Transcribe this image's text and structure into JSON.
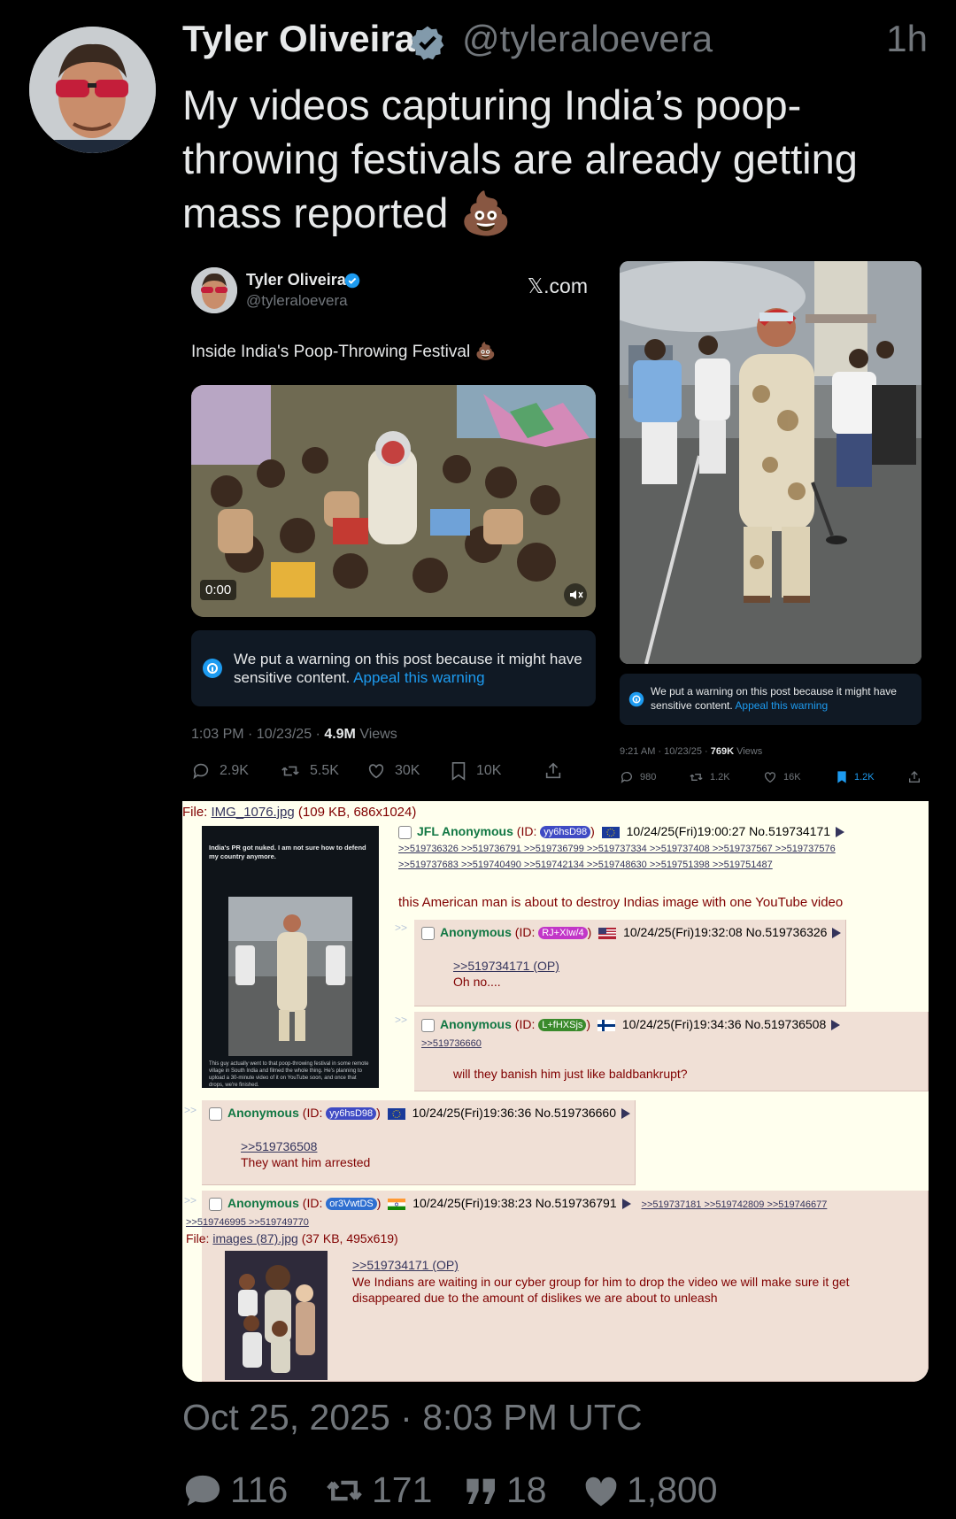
{
  "tweet": {
    "author_name": "Tyler Oliveira",
    "handle": "@tyleraloevera",
    "time_ago": "1h",
    "text": "My videos capturing India’s poop-throwing festivals are already getting mass reported 💩",
    "date_line": "Oct 25, 2025 · 8:03 PM UTC",
    "stats": {
      "replies": "116",
      "retweets": "171",
      "quotes": "18",
      "likes": "1,800"
    }
  },
  "embed1": {
    "author_name": "Tyler Oliveira",
    "handle": "@tyleraloevera",
    "site": "𝕏.com",
    "title": "Inside India's Poop-Throwing Festival 💩",
    "video_time": "0:00",
    "warning_text": "We put a warning on this post because it might have sensitive content.",
    "warning_link": "Appeal this warning",
    "meta_time": "1:03 PM · 10/23/25 · ",
    "meta_views_value": "4.9M",
    "meta_views_label": " Views",
    "actions": {
      "replies": "2.9K",
      "retweets": "5.5K",
      "likes": "30K",
      "bookmarks": "10K"
    }
  },
  "embed2": {
    "warning_text": "We put a warning on this post because it might have sensitive content.",
    "warning_link": "Appeal this warning",
    "meta_time": "9:21 AM · 10/23/25 · ",
    "meta_views_value": "769K",
    "meta_views_label": " Views",
    "actions": {
      "replies": "980",
      "retweets": "1.2K",
      "likes": "16K",
      "bookmarks": "1.2K"
    }
  },
  "chan": {
    "file_label": "File: ",
    "file_name": "IMG_1076.jpg",
    "file_info": " (109 KB, 686x1024)",
    "thumb_text_top": "India's PR got nuked. I am not sure how to defend my country anymore.",
    "thumb_text_bottom": "This guy actually went to that poop-throwing festival in some remote village in South India and filmed the whole thing. He's planning to upload a 30-minute video of it on YouTube soon, and once that drops, we're finished.",
    "op": {
      "name": "JFL Anonymous",
      "id": "yy6hsD98",
      "datetime": "10/24/25(Fri)19:00:27 No.519734171",
      "backlinks1": ">>519736326 >>519736791 >>519736799 >>519737334 >>519737408 >>519737567 >>519737576",
      "backlinks2": ">>519737683 >>519740490 >>519742134 >>519748630 >>519751398 >>519751487",
      "text": "this American man is about to destroy Indias image with one YouTube video"
    },
    "replies": [
      {
        "name": "Anonymous",
        "id": "RJ+XIw/4",
        "datetime": "10/24/25(Fri)19:32:08 No.519736326",
        "quote": ">>519734171 (OP)",
        "text": "Oh no....",
        "backlinks": ""
      },
      {
        "name": "Anonymous",
        "id": "L+fHXSjs",
        "datetime": "10/24/25(Fri)19:34:36 No.519736508",
        "quote": "",
        "text": "will they banish him just like baldbankrupt?",
        "backlinks": ">>519736660"
      },
      {
        "name": "Anonymous",
        "id": "yy6hsD98",
        "datetime": "10/24/25(Fri)19:36:36 No.519736660",
        "quote": ">>519736508",
        "text": "They want him arrested",
        "backlinks": ""
      },
      {
        "name": "Anonymous",
        "id": "or3VwtDS",
        "datetime": "10/24/25(Fri)19:38:23 No.519736791",
        "quote": ">>519734171 (OP)",
        "text": "We Indians are waiting in our cyber group for him to drop the video we will make sure it get disappeared due to the amount of dislikes we are about to unleash",
        "backlinks": ">>519737181 >>519742809 >>519746677",
        "backlinks2": ">>519746995 >>519749770",
        "file_label": "File: ",
        "file_name": "images (87).jpg",
        "file_info": " (37 KB, 495x619)"
      }
    ],
    "id_colors": {
      "op": "#3f4bc4",
      "r1": "#c236c8",
      "r2": "#3a8a2c",
      "r3": "#3f4bc4",
      "r4": "#2f6fd0"
    }
  },
  "icons": [
    "verified-badge-icon",
    "reply-icon",
    "retweet-icon",
    "like-icon",
    "bookmark-icon",
    "share-icon",
    "info-icon",
    "mute-icon",
    "quote-icon"
  ],
  "colors": {
    "background": "#000000",
    "text": "#e7e9ea",
    "muted": "#71767b",
    "link": "#1d9bf0",
    "chan_bg": "#ffffee",
    "chan_reply": "#f0e0d6",
    "chan_name": "#117743",
    "chan_text": "#800000"
  }
}
